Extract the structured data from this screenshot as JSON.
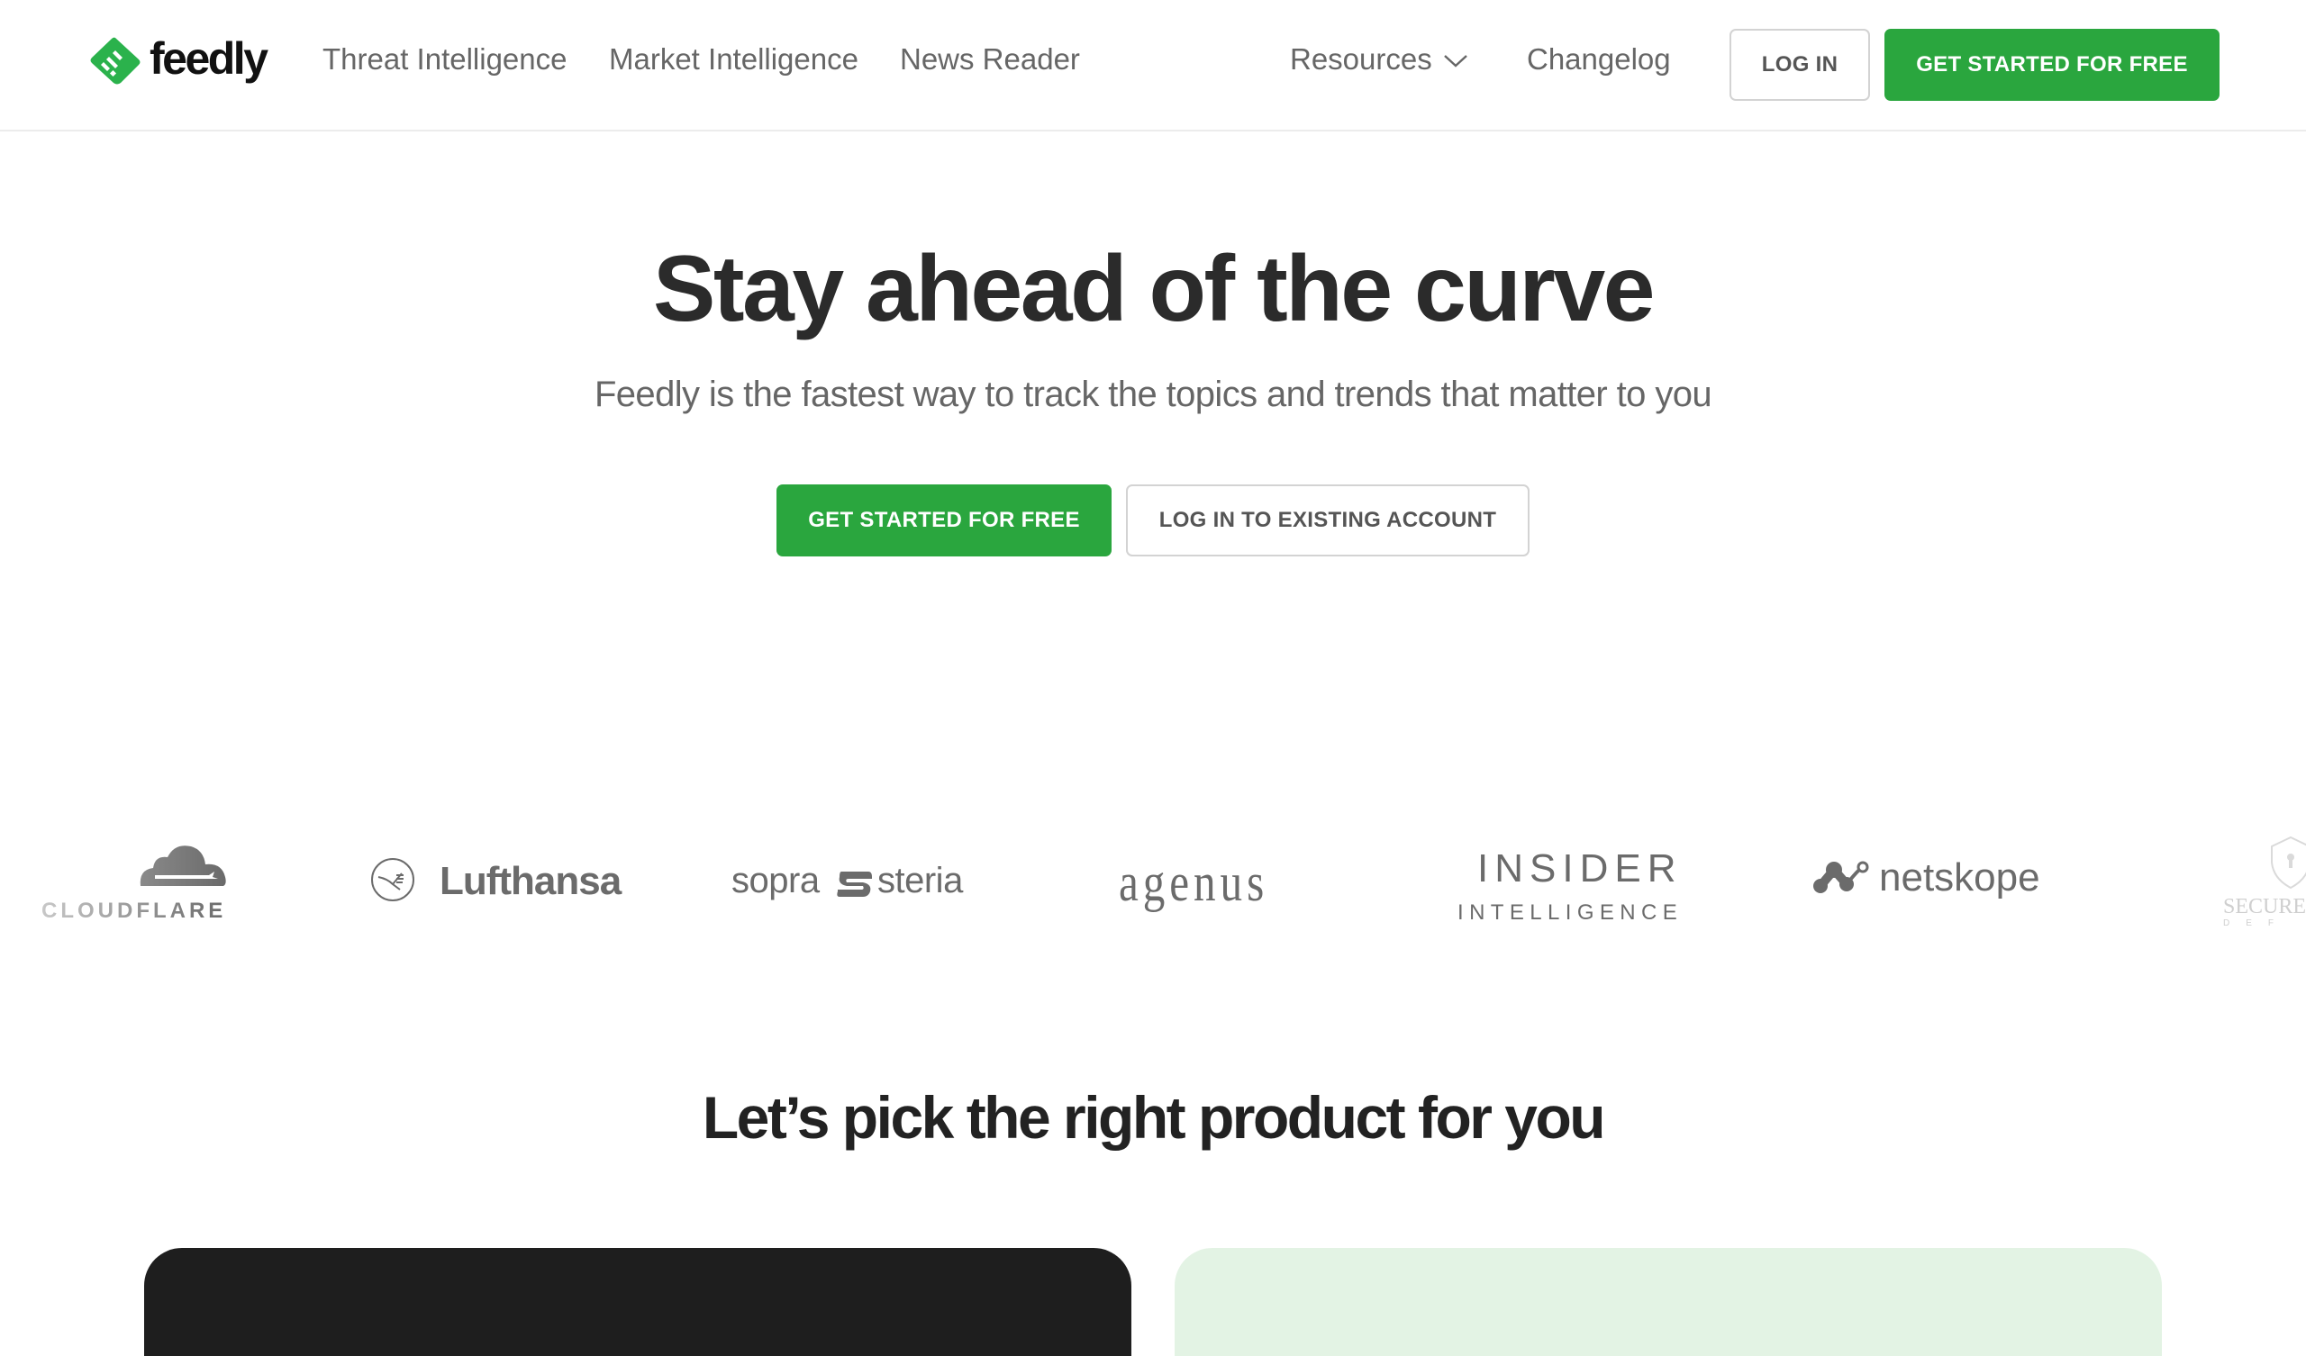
{
  "header": {
    "brand": "feedly",
    "nav": [
      {
        "label": "Threat Intelligence"
      },
      {
        "label": "Market Intelligence"
      },
      {
        "label": "News Reader"
      }
    ],
    "resources_label": "Resources",
    "changelog_label": "Changelog",
    "login_label": "LOG IN",
    "cta_label": "GET STARTED FOR FREE"
  },
  "hero": {
    "title": "Stay ahead of the curve",
    "subtitle": "Feedly is the fastest way to track the topics and trends that matter to you",
    "primary_cta": "GET STARTED FOR FREE",
    "secondary_cta": "LOG IN TO EXISTING ACCOUNT"
  },
  "customers": {
    "logos": [
      {
        "name": "CLOUDFLARE"
      },
      {
        "name": "Lufthansa"
      },
      {
        "name_left": "sopra",
        "name_right": "steria"
      },
      {
        "name": "agenus"
      },
      {
        "line1": "INSIDER",
        "line2": "INTELLIGENCE"
      },
      {
        "name": "netskope"
      },
      {
        "line1": "SECURE",
        "line2": "DEF"
      }
    ]
  },
  "products": {
    "title": "Let’s pick the right product for you"
  },
  "colors": {
    "brand_green": "#2aa63e",
    "dark_card": "#1e1e1e",
    "light_green_card": "#e3f3e4"
  }
}
